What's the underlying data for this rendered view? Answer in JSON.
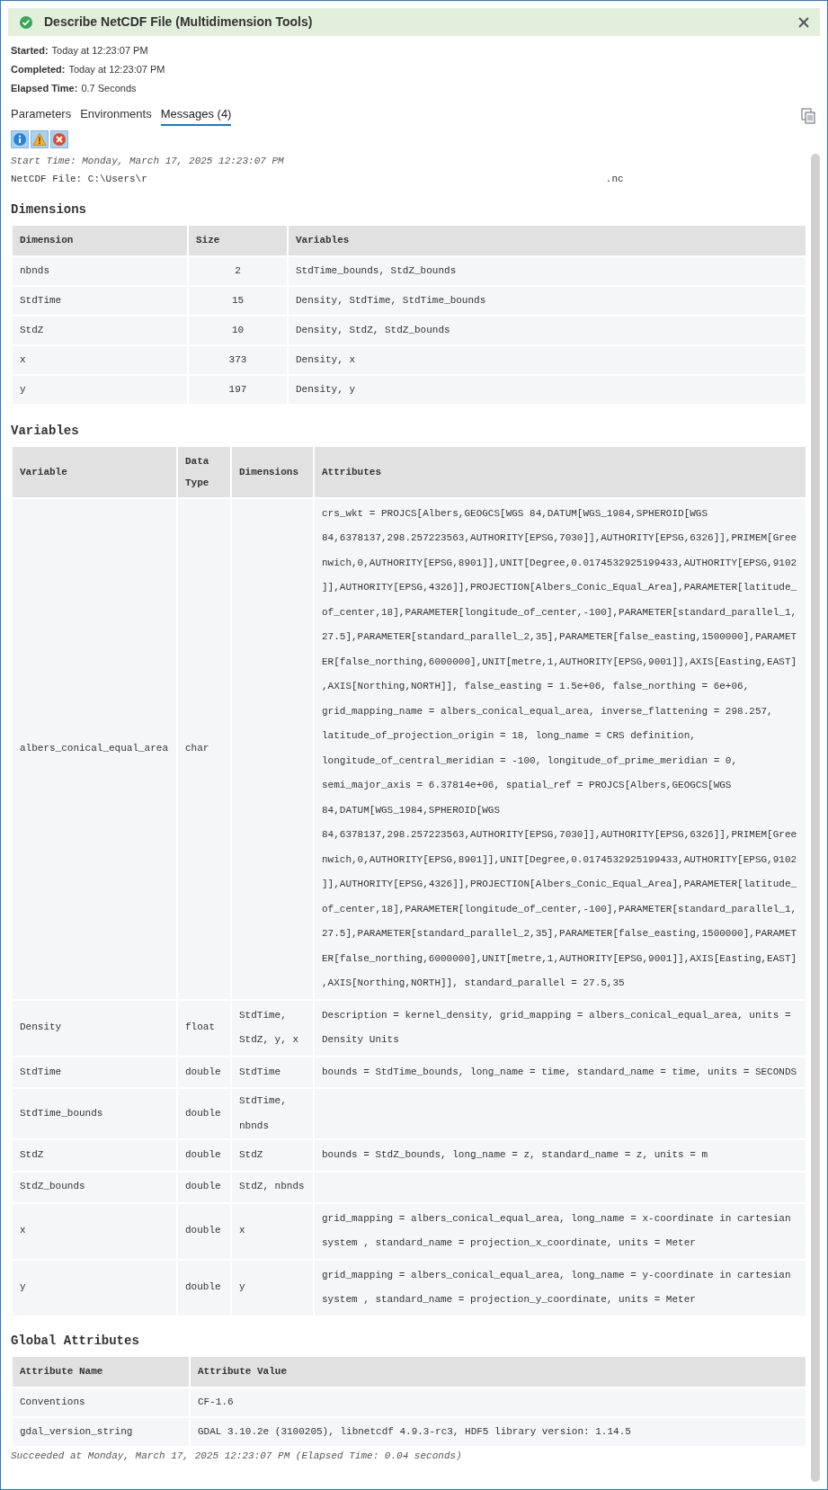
{
  "header": {
    "title": "Describe NetCDF File (Multidimension Tools)",
    "succeeded": true
  },
  "summary": [
    {
      "label": "Started:",
      "value": "Today at 12:23:07 PM"
    },
    {
      "label": "Completed:",
      "value": "Today at 12:23:07 PM"
    },
    {
      "label": "Elapsed Time:",
      "value": "0.7 Seconds"
    }
  ],
  "tabs": [
    {
      "label": "Parameters",
      "selected": false
    },
    {
      "label": "Environments",
      "selected": false
    },
    {
      "label": "Messages (4)",
      "selected": true
    }
  ],
  "filters": [
    {
      "kind": "info",
      "selected": true
    },
    {
      "kind": "warning",
      "selected": true
    },
    {
      "kind": "error",
      "selected": true
    }
  ],
  "messages": {
    "start_time": "Start Time: Monday, March 17, 2025 12:23:07 PM",
    "file_label": "NetCDF File: C:\\Users\\r",
    "file_end": ".nc",
    "succeeded": "Succeeded at Monday, March 17, 2025 12:23:07 PM (Elapsed Time: 0.04 seconds)"
  },
  "dimensions": {
    "heading": "Dimensions",
    "columns": [
      "Dimension",
      "Size",
      "Variables"
    ],
    "rows": [
      [
        "nbnds",
        "2",
        "StdTime_bounds, StdZ_bounds"
      ],
      [
        "StdTime",
        "15",
        "Density, StdTime, StdTime_bounds"
      ],
      [
        "StdZ",
        "10",
        "Density, StdZ, StdZ_bounds"
      ],
      [
        "x",
        "373",
        "Density, x"
      ],
      [
        "y",
        "197",
        "Density, y"
      ]
    ]
  },
  "variables": {
    "heading": "Variables",
    "columns": [
      "Variable",
      "Data Type",
      "Dimensions",
      "Attributes"
    ],
    "rows": [
      [
        "albers_conical_equal_area",
        "char",
        "",
        "crs_wkt = PROJCS[Albers,GEOGCS[WGS 84,DATUM[WGS_1984,SPHEROID[WGS 84,6378137,298.257223563,AUTHORITY[EPSG,7030]],AUTHORITY[EPSG,6326]],PRIMEM[Greenwich,0,AUTHORITY[EPSG,8901]],UNIT[Degree,0.0174532925199433,AUTHORITY[EPSG,9102]],AUTHORITY[EPSG,4326]],PROJECTION[Albers_Conic_Equal_Area],PARAMETER[latitude_of_center,18],PARAMETER[longitude_of_center,-100],PARAMETER[standard_parallel_1,27.5],PARAMETER[standard_parallel_2,35],PARAMETER[false_easting,1500000],PARAMETER[false_northing,6000000],UNIT[metre,1,AUTHORITY[EPSG,9001]],AXIS[Easting,EAST],AXIS[Northing,NORTH]], false_easting = 1.5e+06, false_northing = 6e+06, grid_mapping_name = albers_conical_equal_area, inverse_flattening = 298.257, latitude_of_projection_origin = 18, long_name = CRS definition, longitude_of_central_meridian = -100, longitude_of_prime_meridian = 0, semi_major_axis = 6.37814e+06, spatial_ref = PROJCS[Albers,GEOGCS[WGS 84,DATUM[WGS_1984,SPHEROID[WGS 84,6378137,298.257223563,AUTHORITY[EPSG,7030]],AUTHORITY[EPSG,6326]],PRIMEM[Greenwich,0,AUTHORITY[EPSG,8901]],UNIT[Degree,0.0174532925199433,AUTHORITY[EPSG,9102]],AUTHORITY[EPSG,4326]],PROJECTION[Albers_Conic_Equal_Area],PARAMETER[latitude_of_center,18],PARAMETER[longitude_of_center,-100],PARAMETER[standard_parallel_1,27.5],PARAMETER[standard_parallel_2,35],PARAMETER[false_easting,1500000],PARAMETER[false_northing,6000000],UNIT[metre,1,AUTHORITY[EPSG,9001]],AXIS[Easting,EAST],AXIS[Northing,NORTH]], standard_parallel = 27.5,35"
      ],
      [
        "Density",
        "float",
        "StdTime, StdZ, y, x",
        "Description = kernel_density, grid_mapping = albers_conical_equal_area, units = Density Units"
      ],
      [
        "StdTime",
        "double",
        "StdTime",
        "bounds = StdTime_bounds, long_name = time, standard_name = time, units = SECONDS"
      ],
      [
        "StdTime_bounds",
        "double",
        "StdTime, nbnds",
        ""
      ],
      [
        "StdZ",
        "double",
        "StdZ",
        "bounds = StdZ_bounds, long_name = z, standard_name = z, units = m"
      ],
      [
        "StdZ_bounds",
        "double",
        "StdZ, nbnds",
        ""
      ],
      [
        "x",
        "double",
        "x",
        "grid_mapping = albers_conical_equal_area, long_name = x-coordinate in cartesian system , standard_name = projection_x_coordinate, units = Meter"
      ],
      [
        "y",
        "double",
        "y",
        "grid_mapping = albers_conical_equal_area, long_name = y-coordinate in cartesian system , standard_name = projection_y_coordinate, units = Meter"
      ]
    ]
  },
  "global_attributes": {
    "heading": "Global Attributes",
    "columns": [
      "Attribute Name",
      "Attribute Value"
    ],
    "rows": [
      [
        "Conventions",
        "CF-1.6"
      ],
      [
        "gdal_version_string",
        "GDAL 3.10.2e (3100205), libnetcdf 4.9.3-rc3, HDF5 library version: 1.14.5"
      ]
    ]
  }
}
